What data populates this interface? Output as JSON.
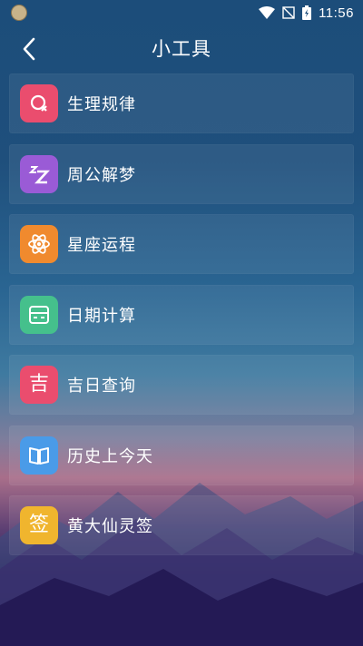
{
  "status_bar": {
    "time": "11:56"
  },
  "header": {
    "title": "小工具",
    "back_icon": "chevron-left-icon"
  },
  "tools": [
    {
      "label": "生理规律",
      "icon": "cycle-icon",
      "color": "#ea4d6e"
    },
    {
      "label": "周公解梦",
      "icon": "sleep-zz-icon",
      "color": "#9a5bd6"
    },
    {
      "label": "星座运程",
      "icon": "atom-icon",
      "color": "#f08a2e"
    },
    {
      "label": "日期计算",
      "icon": "calculator-icon",
      "color": "#45c08c"
    },
    {
      "label": "吉日查询",
      "icon": "ji-character-icon",
      "glyph": "吉",
      "color": "#ea4d6e"
    },
    {
      "label": "历史上今天",
      "icon": "book-icon",
      "color": "#4a9be8"
    },
    {
      "label": "黄大仙灵签",
      "icon": "qian-character-icon",
      "glyph": "签",
      "color": "#f0b52e"
    }
  ]
}
